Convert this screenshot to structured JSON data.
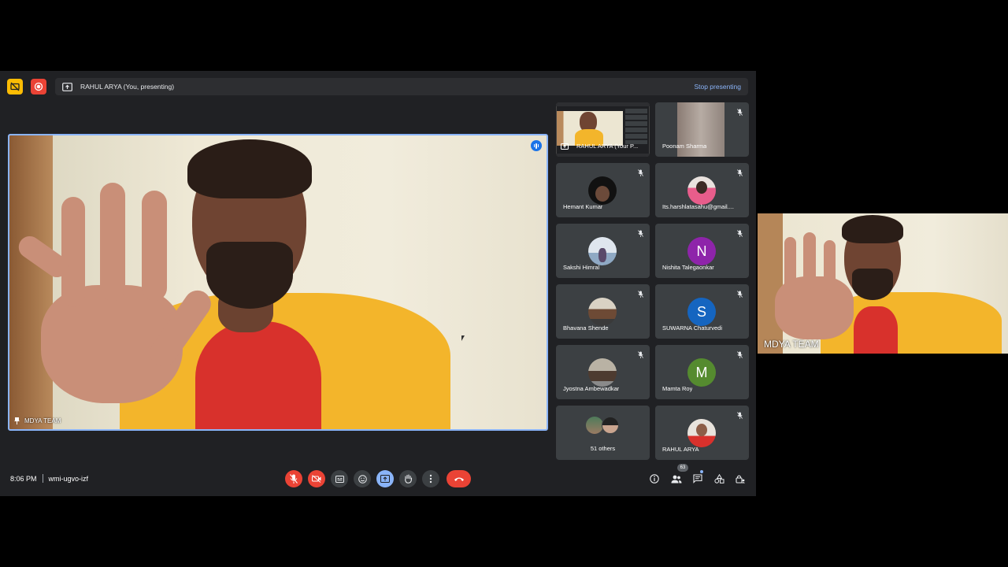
{
  "presenting_bar": {
    "text": "RAHUL ARYA (You, presenting)",
    "stop_label": "Stop presenting"
  },
  "main_video": {
    "name": "MDYA TEAM"
  },
  "self_view": {
    "name": "RAHUL ARYA (Your P..."
  },
  "tiles": [
    {
      "name": "Poonam Sharma"
    },
    {
      "name": "Hemant Kumar"
    },
    {
      "name": "Its.harshlatasahu@gmail...."
    },
    {
      "name": "Sakshi Himral"
    },
    {
      "name": "Nishita Talegaonkar",
      "initial": "N",
      "color": "#8e24aa"
    },
    {
      "name": "Bhavana Shende"
    },
    {
      "name": "SUWARNA Chaturvedi",
      "initial": "S",
      "color": "#1565c0"
    },
    {
      "name": "Jyostna Ambewadkar"
    },
    {
      "name": "Mamta Roy",
      "initial": "M",
      "color": "#558b2f"
    },
    {
      "name": "51 others"
    },
    {
      "name": "RAHUL ARYA"
    }
  ],
  "bottom_bar": {
    "time": "8:06 PM",
    "meeting_code": "wmi-ugvo-izf",
    "participants_count": "63"
  },
  "side_video": {
    "name": "MDYA TEAM"
  },
  "colors": {
    "background": "#202124",
    "tile": "#3c4043",
    "accent_blue": "#8ab4f8",
    "danger_red": "#ea4335"
  }
}
